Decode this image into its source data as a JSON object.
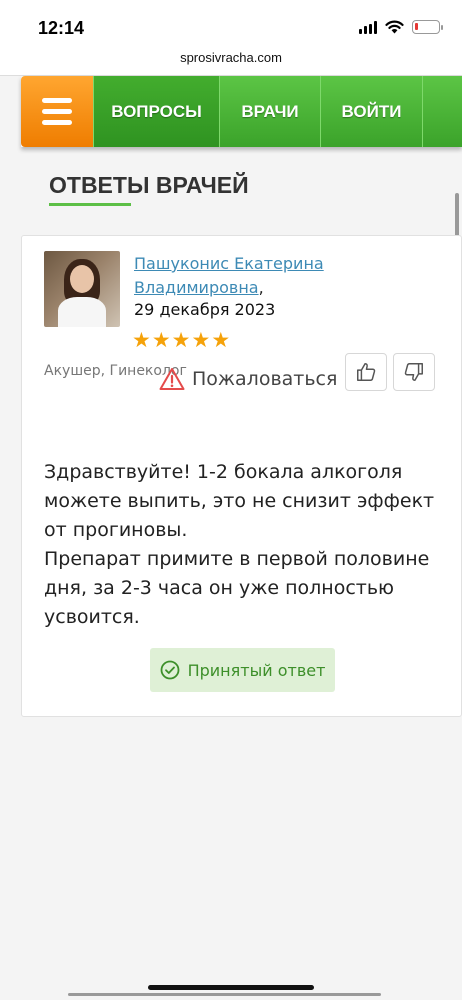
{
  "status_bar": {
    "time": "12:14",
    "icons": [
      "signal-icon",
      "wifi-icon",
      "battery-icon"
    ],
    "battery_color": "#e53935"
  },
  "browser": {
    "url": "sprosivracha.com"
  },
  "nav": {
    "menu_icon": "hamburger-icon",
    "items": [
      {
        "label": "ВОПРОСЫ"
      },
      {
        "label": "ВРАЧИ"
      },
      {
        "label": "ВОЙТИ"
      }
    ],
    "colors": {
      "menu": "#f39016",
      "nav": "#4cb536"
    }
  },
  "section": {
    "title": "ОТВЕТЫ ВРАЧЕЙ"
  },
  "answer": {
    "doctor_name": "Пашуконис Екатерина Владимировна",
    "name_suffix": ",",
    "date": "29 декабря 2023",
    "rating": 5,
    "stars": [
      "★",
      "★",
      "★",
      "★",
      "★"
    ],
    "specialty": "Акушер, Гинеколог",
    "complain_label": "Пожаловаться",
    "text_lines": [
      "Здравствуйте! 1-2 бокала алкоголя",
      "можете выпить, это не снизит эффект",
      "от прогиновы.",
      "Препарат примите в первой половине",
      "дня, за 2-3 часа он уже полностью",
      "усвоится."
    ],
    "accepted_label": "Принятый ответ",
    "colors": {
      "star": "#f5a20a",
      "link": "#3d8ab5",
      "accepted_bg": "#dff0d6",
      "accepted_text": "#3d8f2a"
    }
  }
}
